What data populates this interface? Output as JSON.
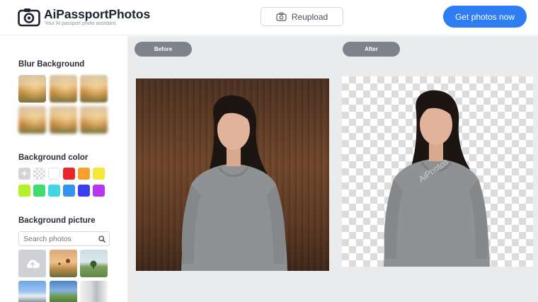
{
  "header": {
    "brand": "AiPassportPhotos",
    "tagline": "Your AI passport photo assistant.",
    "reupload_label": "Reupload",
    "cta_label": "Get photos now"
  },
  "sidebar": {
    "blur_title": "Blur Background",
    "color_title": "Background color",
    "picture_title": "Background picture",
    "search_placeholder": "Search photos",
    "colors": [
      "add",
      "transparent",
      "#ffffff",
      "#e8262b",
      "#f7a12a",
      "#f5e63a",
      "#b6f02b",
      "#3fdc6e",
      "#41d7e0",
      "#3393f0",
      "#3b3ef2",
      "#b538f0"
    ]
  },
  "main": {
    "before_label": "Before",
    "after_label": "After",
    "watermark": "AiPhotos"
  },
  "icons": [
    "camera-logo-icon",
    "camera-icon",
    "search-icon",
    "upload-cloud-icon"
  ]
}
